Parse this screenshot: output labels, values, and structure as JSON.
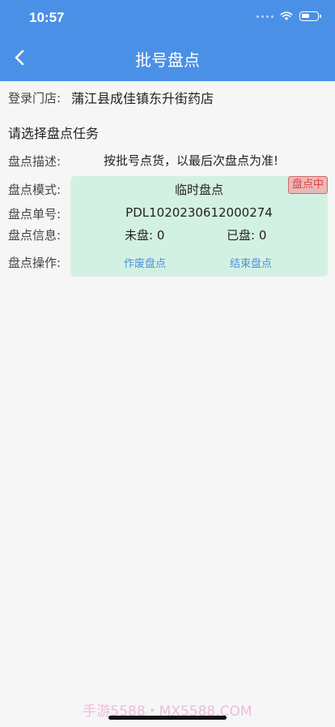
{
  "status_bar": {
    "time": "10:57",
    "battery_level": 0.5
  },
  "header": {
    "title": "批号盘点",
    "back_icon": "chevron-left-icon"
  },
  "store": {
    "label": "登录门店:",
    "value": "蒲江县成佳镇东升街药店"
  },
  "task_heading": "请选择盘点任务",
  "fields": {
    "desc_label": "盘点描述:",
    "desc_value": "按批号点货，以最后次盘点为准!",
    "mode_label": "盘点模式:",
    "order_label": "盘点单号:",
    "info_label": "盘点信息:",
    "op_label": "盘点操作:"
  },
  "card": {
    "title": "临时盘点",
    "status": "盘点中",
    "order_no": "PDL1020230612000274",
    "unpicked": "未盘: 0",
    "picked": "已盘: 0",
    "void_label": "作废盘点",
    "finish_label": "结束盘点",
    "bg_color": "#d3f1e2",
    "status_color": "#e04545",
    "action_color": "#4a90e6"
  },
  "accent_color": "#4a90e6",
  "watermark": "手游5588・MX5588.COM"
}
